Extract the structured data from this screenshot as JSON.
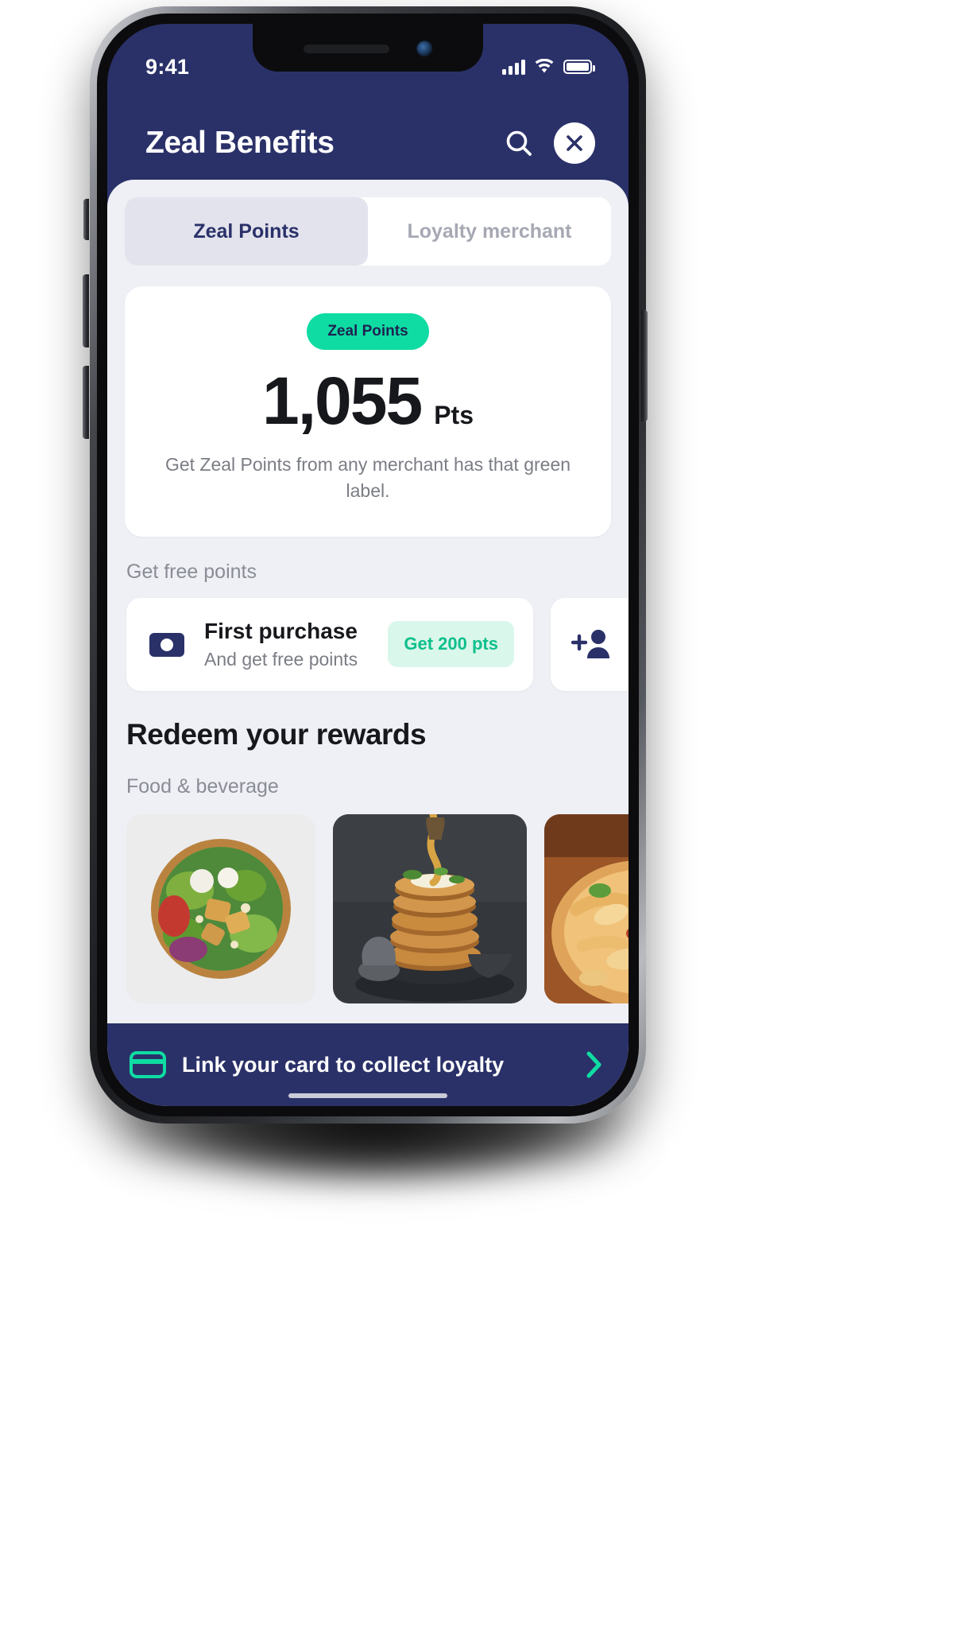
{
  "status_bar": {
    "time": "9:41",
    "icons": [
      "cellular-signal-icon",
      "wifi-icon",
      "battery-icon"
    ]
  },
  "header": {
    "title": "Zeal Benefits",
    "search_icon": "search-icon",
    "close_icon": "close-icon"
  },
  "tabs": [
    {
      "label": "Zeal Points",
      "active": true
    },
    {
      "label": "Loyalty merchant",
      "active": false
    }
  ],
  "points_card": {
    "badge": "Zeal Points",
    "amount": "1,055",
    "unit": "Pts",
    "description": "Get Zeal Points from any merchant has that green label."
  },
  "free_points": {
    "section_label": "Get free points",
    "cards": [
      {
        "icon": "money-card-icon",
        "title": "First purchase",
        "subtitle": "And get free points",
        "pill": "Get 200 pts"
      },
      {
        "icon": "add-person-icon",
        "title": "",
        "subtitle": "",
        "pill": ""
      }
    ]
  },
  "rewards": {
    "section_title": "Redeem your rewards",
    "category_label": "Food & beverage",
    "tiles": [
      {
        "name": "salad-bowl-photo",
        "alt": "Salad bowl with greens and tofu"
      },
      {
        "name": "pancake-stack-photo",
        "alt": "Pancake stack with syrup pour"
      },
      {
        "name": "pizza-photo",
        "alt": "Pizza with toppings"
      }
    ]
  },
  "bottom_bar": {
    "icon": "credit-card-icon",
    "text": "Link your card to collect loyalty",
    "chevron": "chevron-right-icon"
  },
  "colors": {
    "navy": "#2a3169",
    "mint": "#0fdca2",
    "sheet_bg": "#eef0f5",
    "tab_active_bg": "#e3e3ed",
    "pill_bg": "#d9f7ea",
    "pill_text": "#0fbf8c",
    "muted_text": "#7b7d85"
  }
}
